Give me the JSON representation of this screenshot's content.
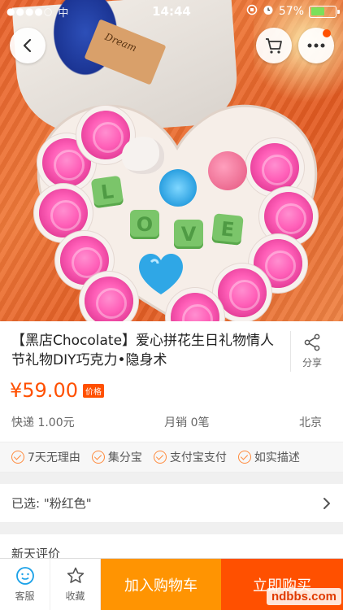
{
  "status_bar": {
    "signal": "●●●●○",
    "carrier": "中",
    "time": "14:44",
    "battery_percent": "57%",
    "battery_level": 0.57
  },
  "hero": {
    "tag_text": "Dream",
    "letters": [
      "L",
      "O",
      "V",
      "E"
    ],
    "colors": {
      "rose": "#ff5fb8",
      "box_orange": "#e8602a",
      "ribbon": "#1b3493",
      "letter_green": "#7bc56a"
    }
  },
  "nav": {
    "back_icon": "chevron-left-icon",
    "cart_icon": "cart-icon",
    "more_icon": "more-dots-icon"
  },
  "product": {
    "title": "【黑店Chocolate】爱心拼花生日礼物情人节礼物DIY巧克力•隐身术",
    "share_label": "分享",
    "price": "¥59.00",
    "price_tag": "价格",
    "shipping": "快递 1.00元",
    "monthly_sales": "月销 0笔",
    "location": "北京"
  },
  "promises": [
    "7天无理由",
    "集分宝",
    "支付宝支付",
    "如实描述"
  ],
  "selection": {
    "label": "已选: \"粉红色\""
  },
  "reviews": {
    "label": "新天评价"
  },
  "bottom_bar": {
    "service_label": "客服",
    "favorite_label": "收藏",
    "add_to_cart": "加入购物车",
    "buy_now": "立即购买",
    "watermark": "ndbbs.com"
  },
  "accent_colors": {
    "price": "#ff5000",
    "add_cart": "#ff9402",
    "buy_now": "#ff5000"
  }
}
